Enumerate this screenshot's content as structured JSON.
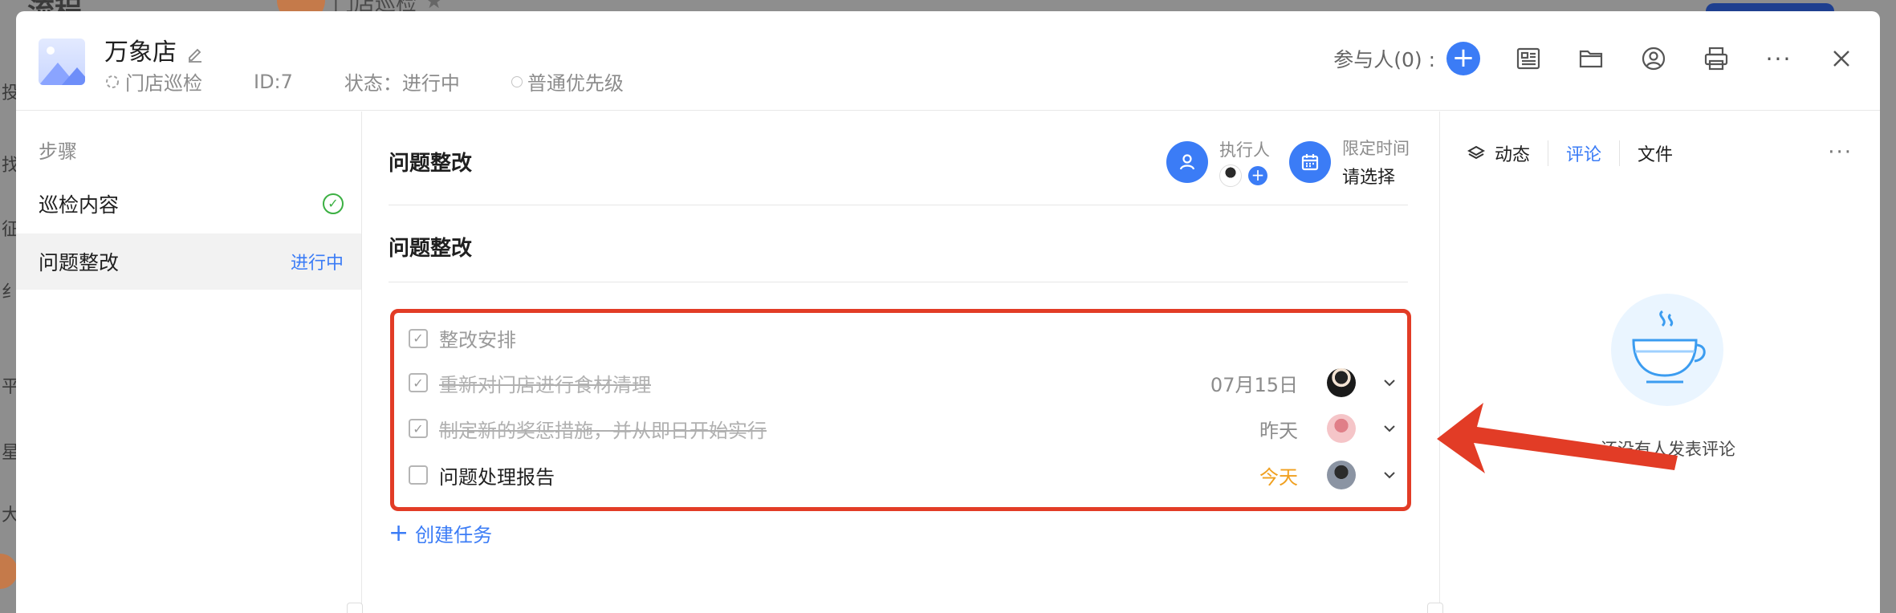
{
  "background": {
    "page_title": "流程",
    "tab_label": "门店巡检",
    "side_chars": [
      "投",
      "找",
      "征",
      "纟",
      "平",
      "星",
      "大"
    ]
  },
  "header": {
    "title": "万象店",
    "type_label": "门店巡检",
    "id_label": "ID:7",
    "status_label": "状态：进行中",
    "priority_label": "普通优先级",
    "participants_label": "参与人(0) :"
  },
  "steps": {
    "label": "步骤",
    "items": [
      {
        "label": "巡检内容",
        "status": ""
      },
      {
        "label": "问题整改",
        "status": "进行中"
      }
    ]
  },
  "main": {
    "section_title": "问题整改",
    "assignee_label": "执行人",
    "deadline_label": "限定时间",
    "deadline_value": "请选择",
    "subsection_title": "问题整改",
    "group_title": "整改安排",
    "tasks": [
      {
        "name": "重新对门店进行食材清理",
        "due": "07月15日",
        "done": true
      },
      {
        "name": "制定新的奖惩措施，并从即日开始实行",
        "due": "昨天",
        "done": true
      },
      {
        "name": "问题处理报告",
        "due": "今天",
        "done": false
      }
    ],
    "create_label": "创建任务"
  },
  "right_panel": {
    "tabs": [
      "动态",
      "评论",
      "文件"
    ],
    "active_tab": "评论",
    "empty_text": "还没有人发表评论"
  },
  "colors": {
    "accent": "#3b7cf6",
    "highlight_border": "#e23c26",
    "today": "#f0a020",
    "success": "#3cb043"
  }
}
